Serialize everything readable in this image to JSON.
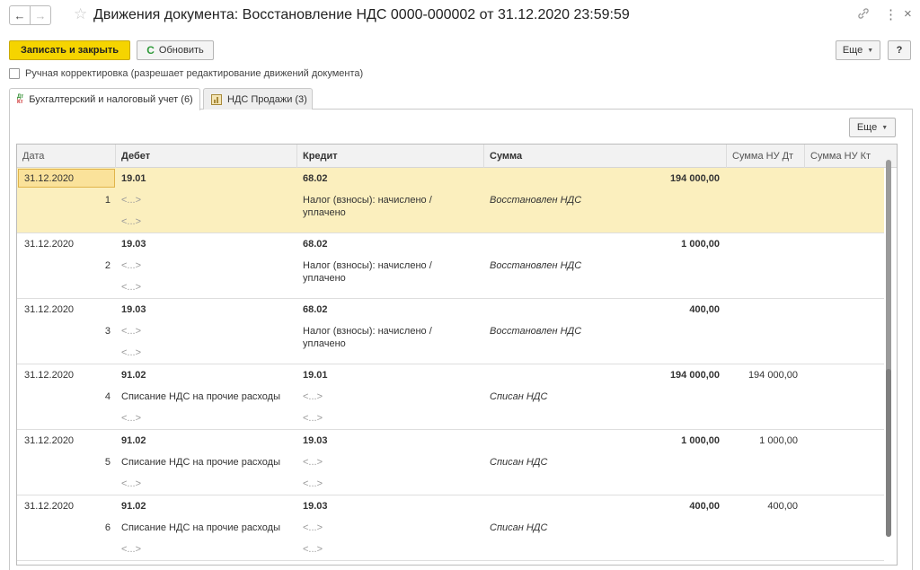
{
  "window": {
    "title": "Движения документа: Восстановление НДС 0000-000002 от 31.12.2020 23:59:59",
    "back_icon": "←",
    "forward_icon": "→",
    "favorite_icon": "☆",
    "link_icon": "🔗",
    "more_icon": "⋮",
    "close_icon": "×"
  },
  "toolbar": {
    "save_close_label": "Записать и закрыть",
    "refresh_label": "Обновить",
    "refresh_icon": "C",
    "more_label": "Еще",
    "help_label": "?"
  },
  "manual_correction": {
    "label": "Ручная корректировка (разрешает редактирование движений документа)",
    "checked": false
  },
  "tabs": [
    {
      "label": "Бухгалтерский и налоговый учет (6)",
      "icon": "dt-kt-icon",
      "active": true
    },
    {
      "label": "НДС Продажи (3)",
      "icon": "chart-icon",
      "active": false
    }
  ],
  "tab_toolbar": {
    "more_label": "Еще"
  },
  "table": {
    "columns": [
      "Дата",
      "Дебет",
      "Кредит",
      "Сумма",
      "Сумма НУ Дт",
      "Сумма НУ Кт"
    ],
    "records": [
      {
        "date": "31.12.2020",
        "num": "1",
        "debit": "19.01",
        "debit_sub1": "<...>",
        "debit_sub2": "<...>",
        "credit": "68.02",
        "credit_sub1": "Налог (взносы): начислено /",
        "credit_sub1b": "уплачено",
        "credit_sub2": "",
        "amount": "194 000,00",
        "content": "Восстановлен НДС",
        "nu_dt": "",
        "nu_kt": ""
      },
      {
        "date": "31.12.2020",
        "num": "2",
        "debit": "19.03",
        "debit_sub1": "<...>",
        "debit_sub2": "<...>",
        "credit": "68.02",
        "credit_sub1": "Налог (взносы): начислено /",
        "credit_sub1b": "уплачено",
        "credit_sub2": "",
        "amount": "1 000,00",
        "content": "Восстановлен НДС",
        "nu_dt": "",
        "nu_kt": ""
      },
      {
        "date": "31.12.2020",
        "num": "3",
        "debit": "19.03",
        "debit_sub1": "<...>",
        "debit_sub2": "<...>",
        "credit": "68.02",
        "credit_sub1": "Налог (взносы): начислено /",
        "credit_sub1b": "уплачено",
        "credit_sub2": "",
        "amount": "400,00",
        "content": "Восстановлен НДС",
        "nu_dt": "",
        "nu_kt": ""
      },
      {
        "date": "31.12.2020",
        "num": "4",
        "debit": "91.02",
        "debit_sub1": "Списание НДС на прочие расходы",
        "debit_sub2": "<...>",
        "credit": "19.01",
        "credit_sub1": "<...>",
        "credit_sub1b": "",
        "credit_sub2": "<...>",
        "amount": "194 000,00",
        "content": "Списан НДС",
        "nu_dt": "194 000,00",
        "nu_kt": ""
      },
      {
        "date": "31.12.2020",
        "num": "5",
        "debit": "91.02",
        "debit_sub1": "Списание НДС на прочие расходы",
        "debit_sub2": "<...>",
        "credit": "19.03",
        "credit_sub1": "<...>",
        "credit_sub1b": "",
        "credit_sub2": "<...>",
        "amount": "1 000,00",
        "content": "Списан НДС",
        "nu_dt": "1 000,00",
        "nu_kt": ""
      },
      {
        "date": "31.12.2020",
        "num": "6",
        "debit": "91.02",
        "debit_sub1": "Списание НДС на прочие расходы",
        "debit_sub2": "<...>",
        "credit": "19.03",
        "credit_sub1": "<...>",
        "credit_sub1b": "",
        "credit_sub2": "<...>",
        "amount": "400,00",
        "content": "Списан НДС",
        "nu_dt": "400,00",
        "nu_kt": ""
      }
    ]
  },
  "colors": {
    "primary_button": "#f5d400",
    "selected_row": "#fbefbe",
    "refresh_icon": "#2f9a3a"
  }
}
